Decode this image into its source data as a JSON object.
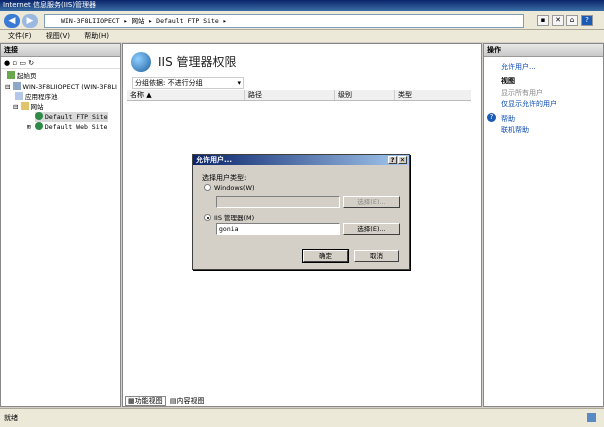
{
  "window": {
    "title": "Internet 信息服务(IIS)管理器"
  },
  "address": {
    "path": "WIN-3F8LIIOPECT ▸ 网站 ▸ Default FTP Site ▸"
  },
  "menu": {
    "file": "文件(F)",
    "view": "视图(V)",
    "help": "帮助(H)"
  },
  "connections": {
    "header": "连接",
    "tree": [
      {
        "label": "起始页"
      },
      {
        "label": "WIN-3F8LIIOPECT (WIN-3F8LI"
      },
      {
        "label": "应用程序池"
      },
      {
        "label": "网站"
      },
      {
        "label": "Default FTP Site"
      },
      {
        "label": "Default Web Site"
      }
    ]
  },
  "main": {
    "title": "IIS 管理器权限",
    "group_label": "分组依据:",
    "group_value": "不进行分组",
    "columns": [
      "名称 ▲",
      "路径",
      "级别",
      "类型"
    ],
    "tabs": {
      "features": "功能视图",
      "content": "内容视图"
    }
  },
  "actions": {
    "header": "操作",
    "allow_user": "允许用户...",
    "view_header": "视图",
    "show_all": "显示所有用户",
    "show_allowed": "仅显示允许的用户",
    "help": "帮助",
    "online_help": "联机帮助"
  },
  "dialog": {
    "title": "允许用户...",
    "section": "选择用户类型:",
    "windows_label": "Windows(W)",
    "windows_value": "",
    "iis_label": "IIS 管理器(M)",
    "iis_value": "gonia",
    "select_disabled": "选择(E)...",
    "select": "选择(E)...",
    "ok": "确定",
    "cancel": "取消"
  },
  "status": {
    "text": "就绪"
  }
}
